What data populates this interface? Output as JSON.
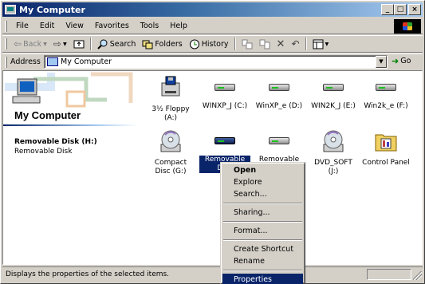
{
  "window": {
    "title": "My Computer"
  },
  "menubar": {
    "items": [
      "File",
      "Edit",
      "View",
      "Favorites",
      "Tools",
      "Help"
    ]
  },
  "toolbar": {
    "back_label": "Back",
    "search_label": "Search",
    "folders_label": "Folders",
    "history_label": "History"
  },
  "addressbar": {
    "label": "Address",
    "value": "My Computer",
    "go_label": "Go"
  },
  "leftpanel": {
    "title": "My Computer",
    "selected_name": "Removable Disk (H:)",
    "selected_type": "Removable Disk"
  },
  "drives": [
    {
      "label": "3½ Floppy (A:)",
      "icon": "floppy-drive-icon"
    },
    {
      "label": "WINXP_J (C:)",
      "icon": "hard-disk-icon"
    },
    {
      "label": "WinXP_e (D:)",
      "icon": "hard-disk-icon"
    },
    {
      "label": "WIN2K_J (E:)",
      "icon": "hard-disk-icon"
    },
    {
      "label": "Win2k_e (F:)",
      "icon": "hard-disk-icon"
    },
    {
      "label": "Compact Disc (G:)",
      "icon": "cd-drive-icon"
    },
    {
      "label": "Removable Disk",
      "icon": "removable-disk-icon",
      "selected": true
    },
    {
      "label": "Removable",
      "icon": "removable-disk-icon"
    },
    {
      "label": "DVD_SOFT (J:)",
      "icon": "cd-drive-icon"
    },
    {
      "label": "Control Panel",
      "icon": "control-panel-folder-icon"
    }
  ],
  "context_menu": {
    "items": [
      "Open",
      "Explore",
      "Search...",
      "Sharing...",
      "Format...",
      "Create Shortcut",
      "Rename",
      "Properties"
    ]
  },
  "statusbar": {
    "text": "Displays the properties of the selected items."
  },
  "colors": {
    "selection": "#0a246a",
    "face": "#d4d0c8",
    "titlebar_start": "#0a246a",
    "titlebar_end": "#a6caf0"
  }
}
